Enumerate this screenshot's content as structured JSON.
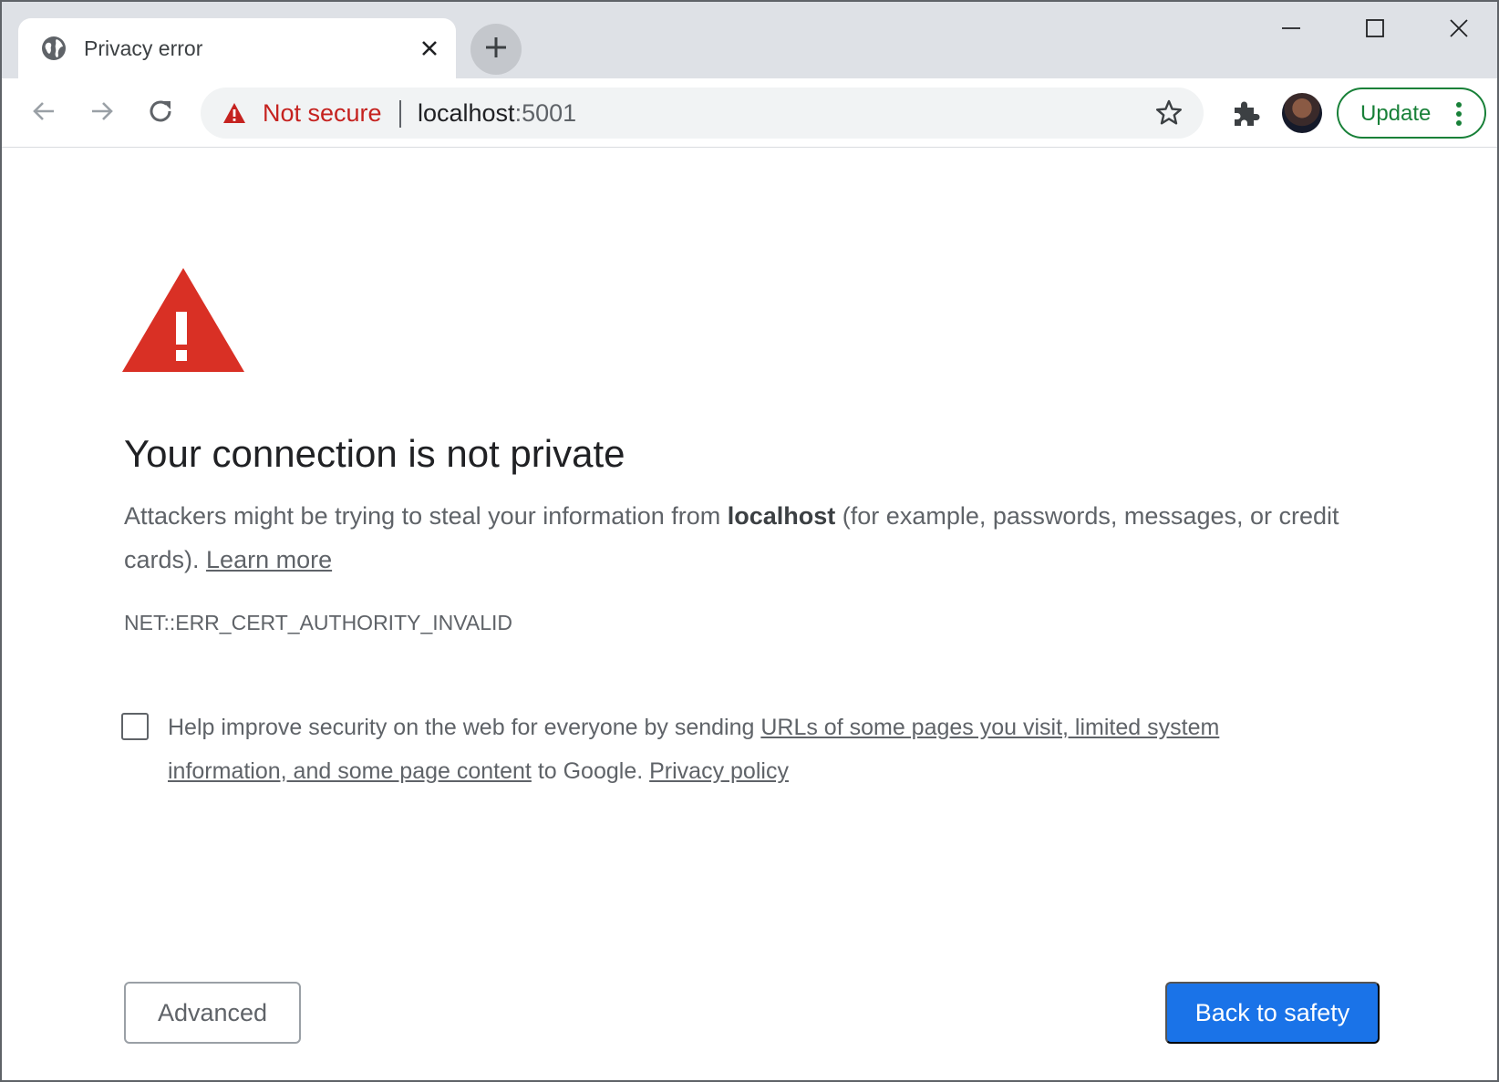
{
  "tab": {
    "title": "Privacy error"
  },
  "toolbar": {
    "security_label": "Not secure",
    "url_host": "localhost",
    "url_port": ":5001",
    "update_label": "Update"
  },
  "page": {
    "heading": "Your connection is not private",
    "desc_before": "Attackers might be trying to steal your information from ",
    "desc_host": "localhost",
    "desc_after": " (for example, passwords, messages, or credit cards). ",
    "learn_more": "Learn more",
    "error_code": "NET::ERR_CERT_AUTHORITY_INVALID",
    "optin_before": "Help improve security on the web for everyone by sending ",
    "optin_link": "URLs of some pages you visit, limited system information, and some page content",
    "optin_middle": " to Google. ",
    "privacy_policy": "Privacy policy",
    "advanced_button": "Advanced",
    "back_button": "Back to safety",
    "checkbox_checked": false
  },
  "colors": {
    "warning_red": "#d93025",
    "not_secure_red": "#c5221f",
    "primary_blue": "#1a73e8",
    "update_green": "#188038",
    "text_gray": "#5f6368"
  },
  "icons": {
    "favicon": "globe-icon",
    "tab_close": "close-icon",
    "new_tab": "plus-icon",
    "back": "arrow-left-icon",
    "forward": "arrow-right-icon",
    "reload": "reload-icon",
    "warning": "warning-triangle-icon",
    "bookmark": "star-icon",
    "extensions": "puzzle-icon",
    "menu": "three-dots-icon"
  }
}
